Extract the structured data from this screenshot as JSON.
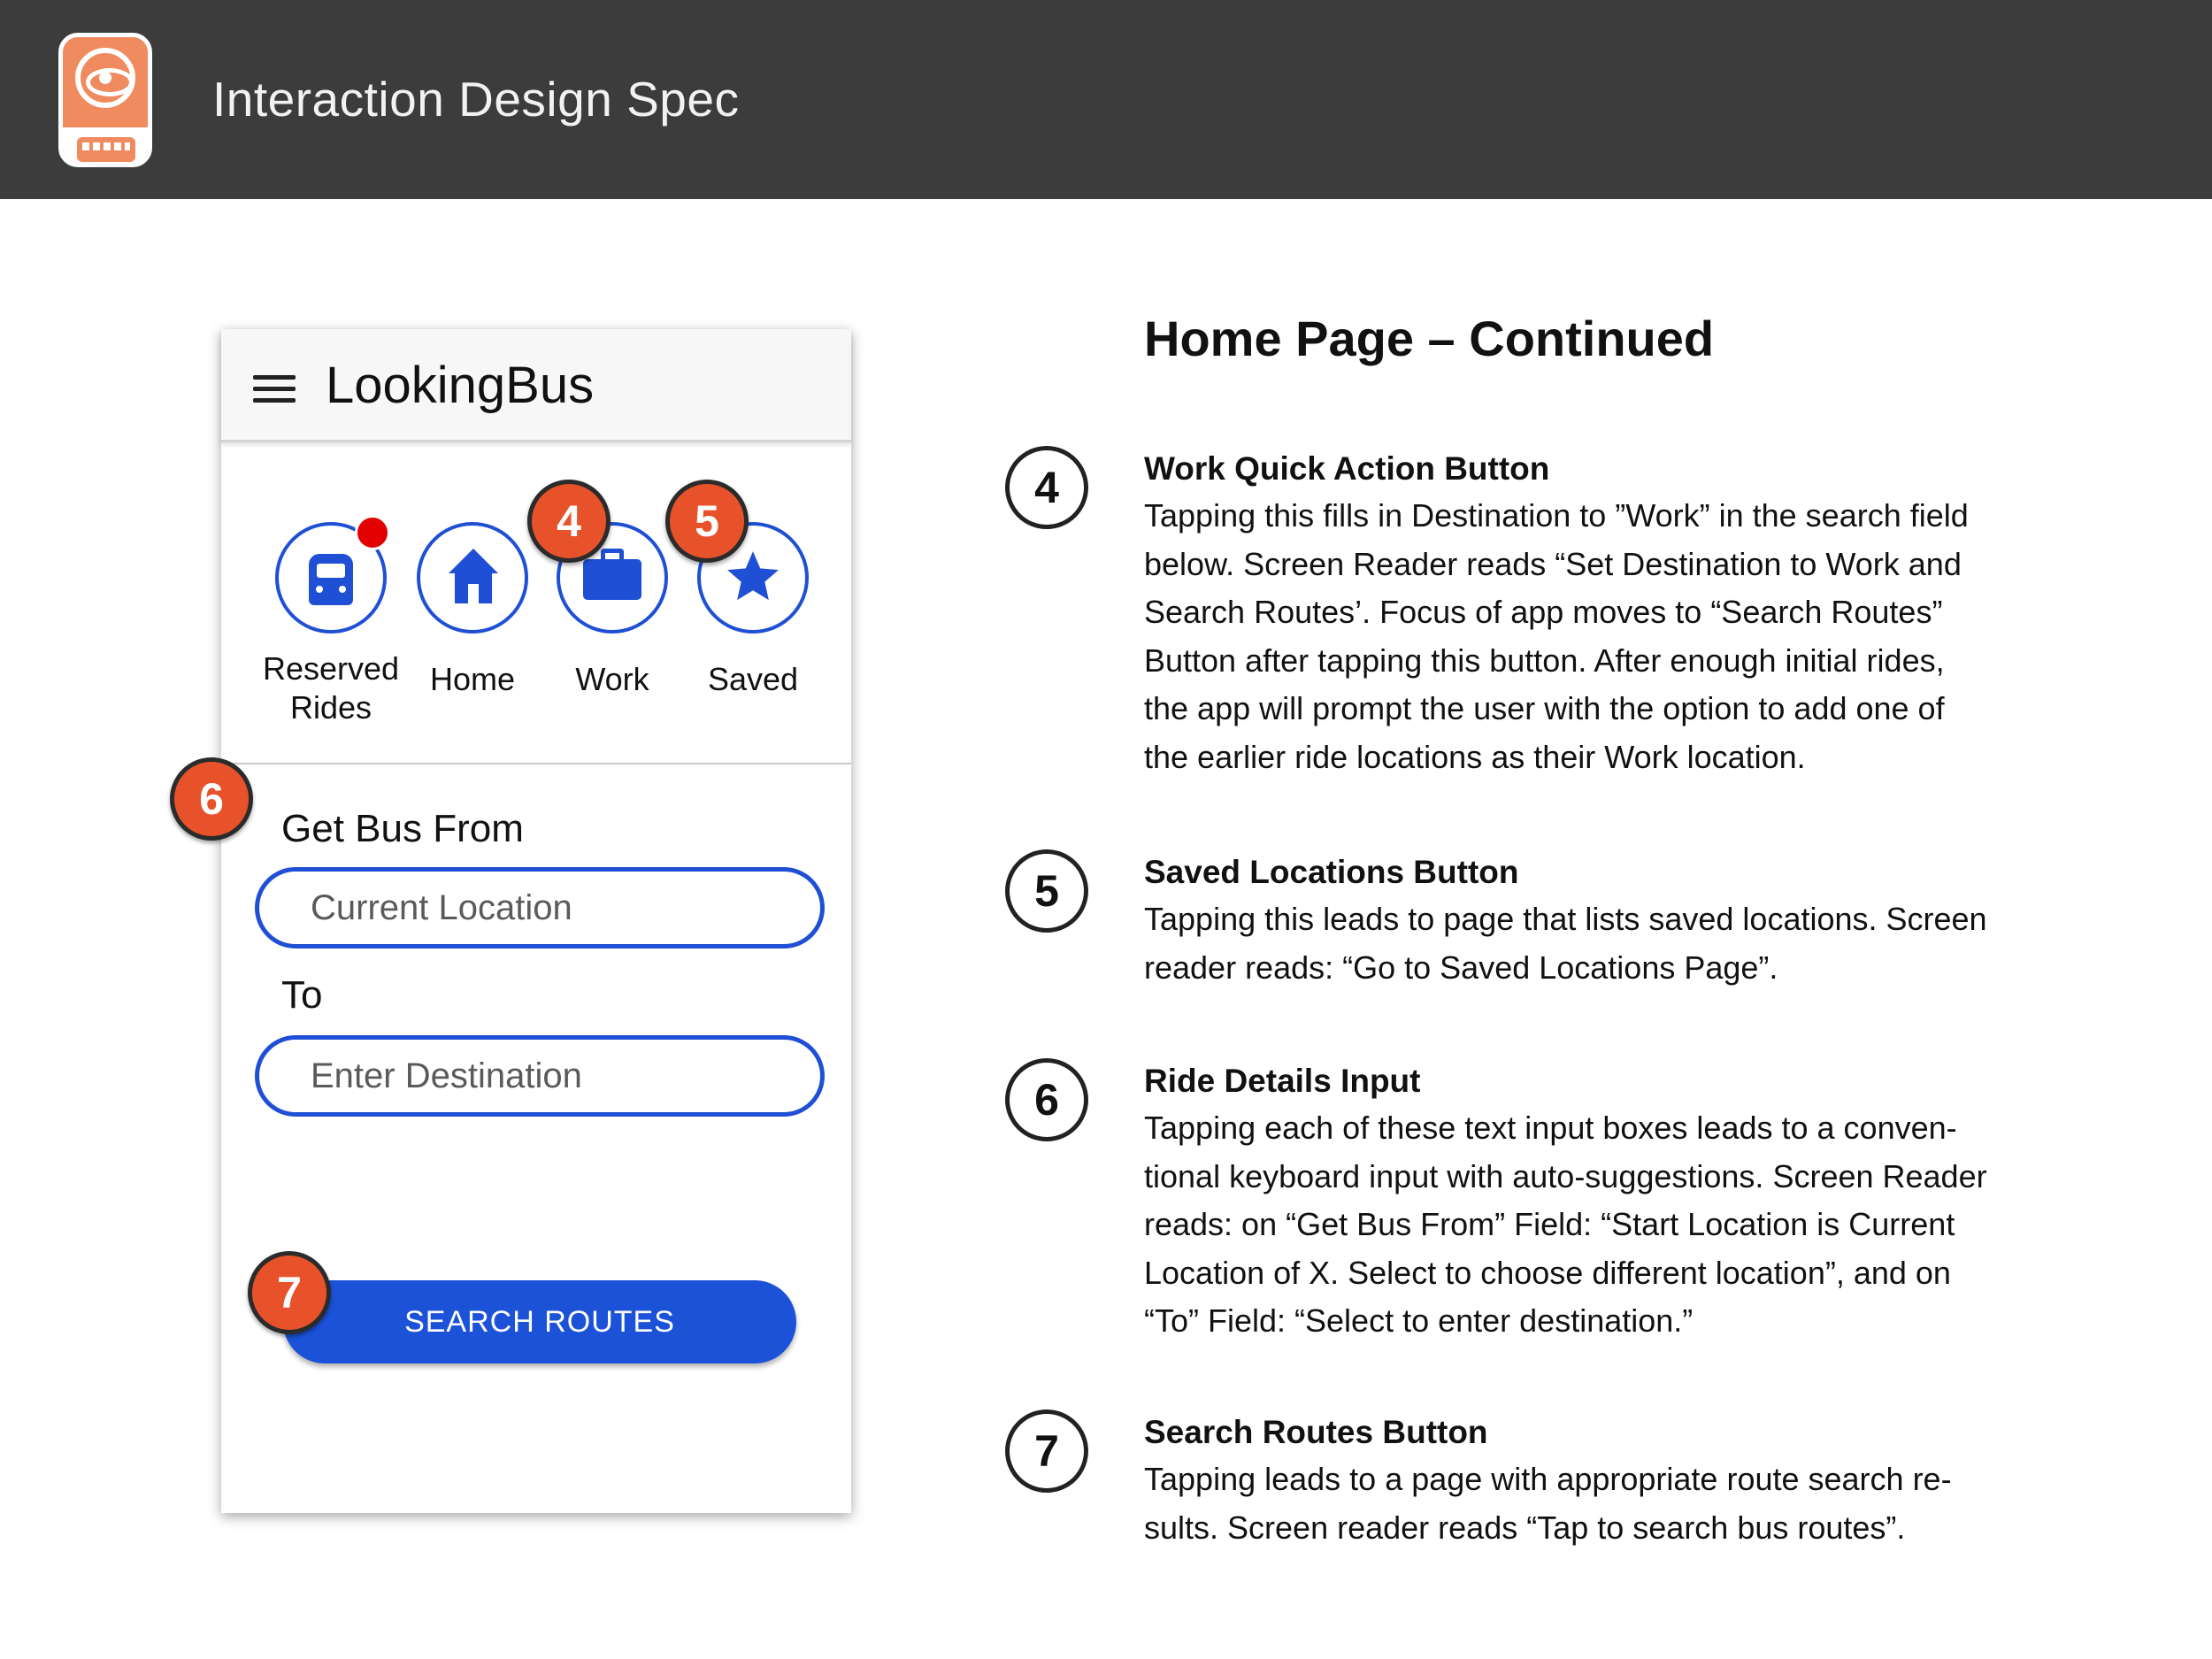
{
  "header": {
    "title": "Interaction Design Spec",
    "logo_icon": "lookingbus-eye-bus-logo"
  },
  "colors": {
    "header_bg": "#3c3c3c",
    "accent_blue": "#1f4fd4",
    "badge_orange": "#e8522a",
    "notification_red": "#e20000",
    "logo_orange": "#f08a5f"
  },
  "phone": {
    "app_name": "LookingBus",
    "menu_icon": "hamburger-menu-icon",
    "quick_actions": [
      {
        "label": "Reserved\nRides",
        "icon": "bus-icon",
        "notification": true
      },
      {
        "label": "Home",
        "icon": "home-icon"
      },
      {
        "label": "Work",
        "icon": "briefcase-icon"
      },
      {
        "label": "Saved",
        "icon": "star-icon"
      }
    ],
    "from_label": "Get Bus From",
    "from_placeholder": "Current Location",
    "to_label": "To",
    "to_placeholder": "Enter Destination",
    "search_button": "SEARCH ROUTES",
    "badges": [
      "4",
      "5",
      "6",
      "7"
    ]
  },
  "spec": {
    "title": "Home Page – Continued",
    "items": [
      {
        "number": "4",
        "heading": "Work Quick Action Button",
        "body": "Tapping this fills in Destination to ”Work” in the search field\nbelow. Screen Reader reads “Set Destination to Work and\nSearch Routes’. Focus of app moves to “Search Routes”\nButton after tapping this button. After enough initial rides,\nthe app will prompt the user with the option to add one of\nthe earlier ride locations as their Work location."
      },
      {
        "number": "5",
        "heading": "Saved Locations Button",
        "body": "Tapping this leads to page that lists saved locations. Screen\nreader reads: “Go to Saved Locations Page”."
      },
      {
        "number": "6",
        "heading": "Ride Details Input",
        "body": "Tapping each of these text input boxes leads to a conven-\ntional keyboard input with auto-suggestions. Screen Reader\nreads: on “Get Bus From” Field: “Start Location is Current\nLocation of X. Select to choose different location”, and on\n“To” Field: “Select to enter destination.”"
      },
      {
        "number": "7",
        "heading": "Search Routes Button",
        "body": "Tapping leads to a page with appropriate route search re-\nsults.  Screen reader reads “Tap to search bus routes”."
      }
    ]
  }
}
